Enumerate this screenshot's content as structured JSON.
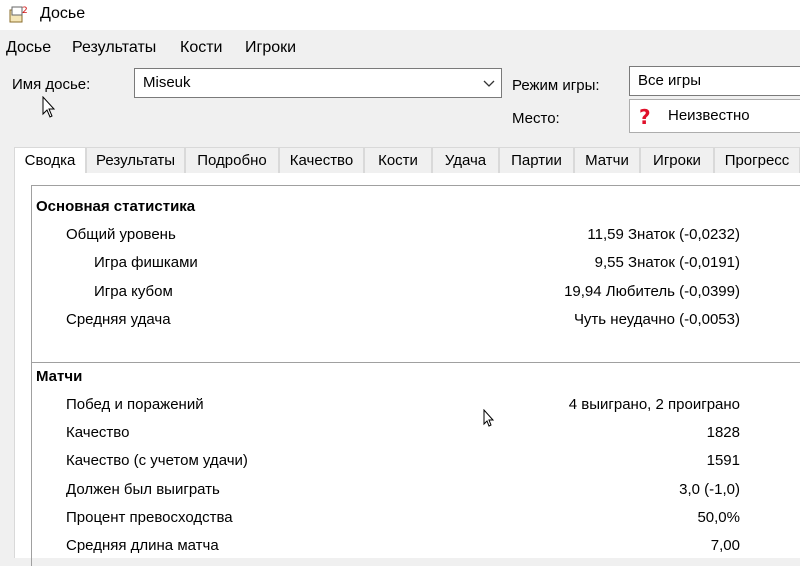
{
  "window": {
    "title": "Досье"
  },
  "menu": [
    "Досье",
    "Результаты",
    "Кости",
    "Игроки"
  ],
  "form": {
    "dossier_name_label": "Имя досье:",
    "dossier_name_value": "Miseuk",
    "game_mode_label": "Режим игры:",
    "game_mode_value": "Все игры",
    "place_label": "Место:",
    "place_value": "Неизвестно"
  },
  "tabs": [
    "Сводка",
    "Результаты",
    "Подробно",
    "Качество",
    "Кости",
    "Удача",
    "Партии",
    "Матчи",
    "Игроки",
    "Прогресс"
  ],
  "active_tab_index": 0,
  "sections": [
    {
      "title": "Основная статистика",
      "rows": [
        {
          "label": "Общий уровень",
          "value": "11,59 Знаток (-0,0232)"
        },
        {
          "label": "Игра фишками",
          "value": "9,55 Знаток (-0,0191)"
        },
        {
          "label": "Игра кубом",
          "value": "19,94 Любитель (-0,0399)"
        },
        {
          "label": "Средняя удача",
          "value": "Чуть неудачно (-0,0053)"
        }
      ]
    },
    {
      "title": "Матчи",
      "rows": [
        {
          "label": "Побед и поражений",
          "value": "4 выиграно, 2 проиграно"
        },
        {
          "label": "Качество",
          "value": "1828"
        },
        {
          "label": "Качество (с учетом удачи)",
          "value": "1591"
        },
        {
          "label": "Должен был выиграть",
          "value": "3,0 (-1,0)"
        },
        {
          "label": "Процент превосходства",
          "value": "50,0%"
        },
        {
          "label": "Средняя длина матча",
          "value": "7,00"
        }
      ]
    }
  ],
  "colors": {
    "place_icon": "#e0102a",
    "window_bg": "#f0f0f0"
  },
  "icons": {
    "app": "dossier-app-icon",
    "place": "question-mark-icon",
    "dropdown": "chevron-down-icon"
  }
}
